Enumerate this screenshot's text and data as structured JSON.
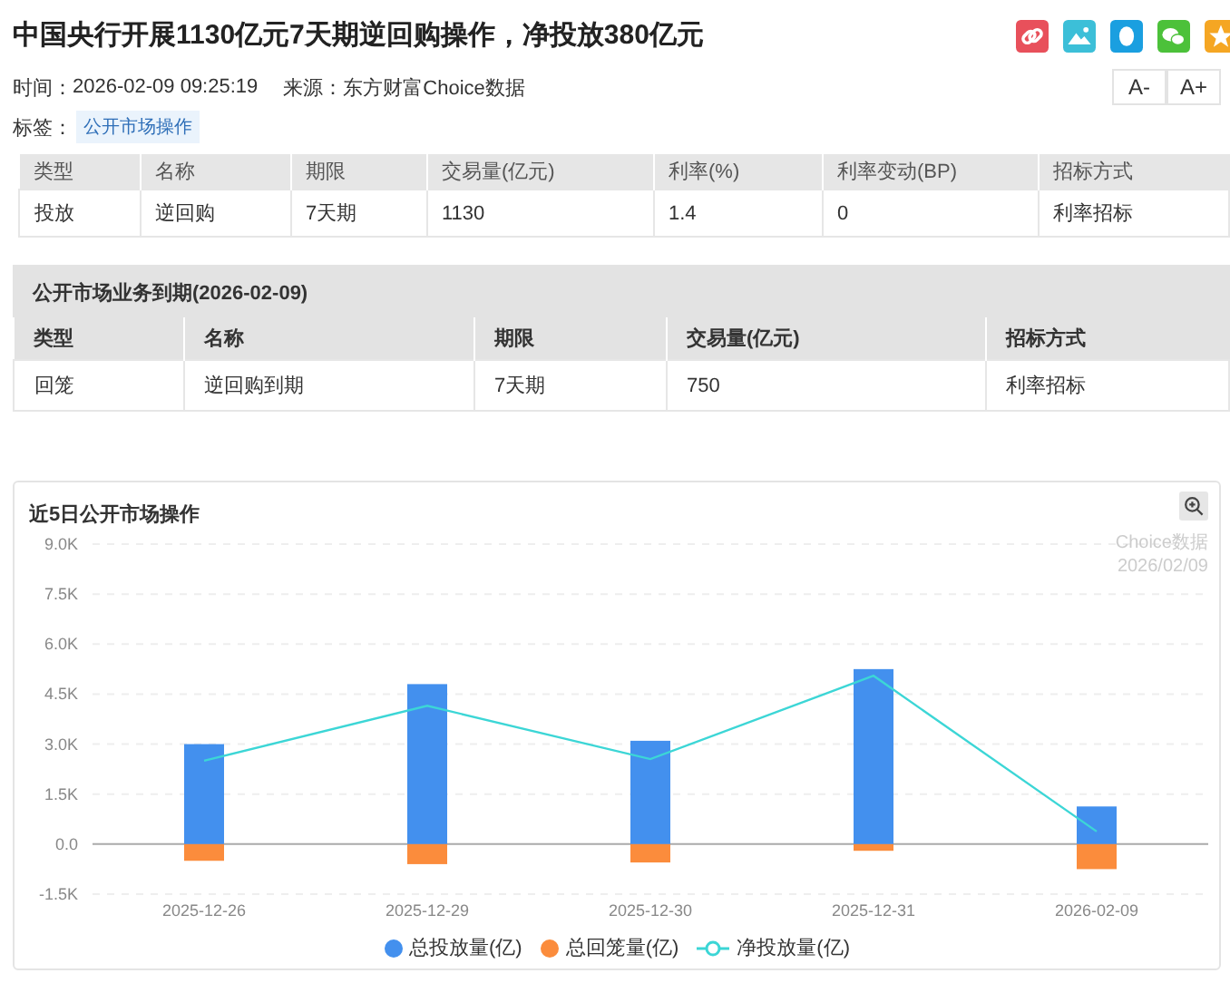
{
  "article": {
    "title": "中国央行开展1130亿元7天期逆回购操作，净投放380亿元",
    "time_label": "时间：",
    "time": "2026-02-09 09:25:19",
    "source_label": "来源：",
    "source": "东方财富Choice数据",
    "tags_label": "标签：",
    "tags": [
      "公开市场操作"
    ]
  },
  "share_icons": [
    {
      "kind": "link",
      "color": "#e8505b"
    },
    {
      "kind": "picture",
      "color": "#3cbfd8"
    },
    {
      "kind": "qq",
      "color": "#1a9fe0"
    },
    {
      "kind": "wechat",
      "color": "#4cc13a"
    },
    {
      "kind": "star",
      "color": "#f5a623"
    }
  ],
  "font_buttons": [
    "A-",
    "A+"
  ],
  "operations_table": {
    "columns": [
      "类型",
      "名称",
      "期限",
      "交易量(亿元)",
      "利率(%)",
      "利率变动(BP)",
      "招标方式"
    ],
    "rows": [
      [
        "投放",
        "逆回购",
        "7天期",
        "1130",
        "1.4",
        "0",
        "利率招标"
      ]
    ]
  },
  "maturity_table": {
    "title": "公开市场业务到期(2026-02-09)",
    "columns": [
      "类型",
      "名称",
      "期限",
      "交易量(亿元)",
      "招标方式"
    ],
    "rows": [
      [
        "回笼",
        "逆回购到期",
        "7天期",
        "750",
        "利率招标"
      ]
    ]
  },
  "chart": {
    "title": "近5日公开市场操作",
    "source": "Choice数据",
    "source_date": "2026/02/09",
    "chart_data": {
      "type": "bar",
      "stacked": true,
      "grid": true,
      "categories": [
        "2025-12-26",
        "2025-12-29",
        "2025-12-30",
        "2025-12-31",
        "2026-02-09"
      ],
      "series": [
        {
          "name": "总投放量(亿)",
          "color": "#4390ee",
          "type": "bar",
          "values": [
            3000,
            4800,
            3100,
            5250,
            1130
          ]
        },
        {
          "name": "总回笼量(亿)",
          "color": "#fb8c3c",
          "type": "bar",
          "values": [
            -500,
            -600,
            -550,
            -200,
            -750
          ]
        },
        {
          "name": "净投放量(亿)",
          "color": "#3cd6d6",
          "type": "line",
          "values": [
            2500,
            4150,
            2550,
            5050,
            380
          ]
        }
      ],
      "ylim": [
        -1500,
        9000
      ],
      "yticks": [
        {
          "value": -1500,
          "label": "-1.5K"
        },
        {
          "value": 0,
          "label": "0.0"
        },
        {
          "value": 1500,
          "label": "1.5K"
        },
        {
          "value": 3000,
          "label": "3.0K"
        },
        {
          "value": 4500,
          "label": "4.5K"
        },
        {
          "value": 6000,
          "label": "6.0K"
        },
        {
          "value": 7500,
          "label": "7.5K"
        },
        {
          "value": 9000,
          "label": "9.0K"
        }
      ]
    }
  }
}
